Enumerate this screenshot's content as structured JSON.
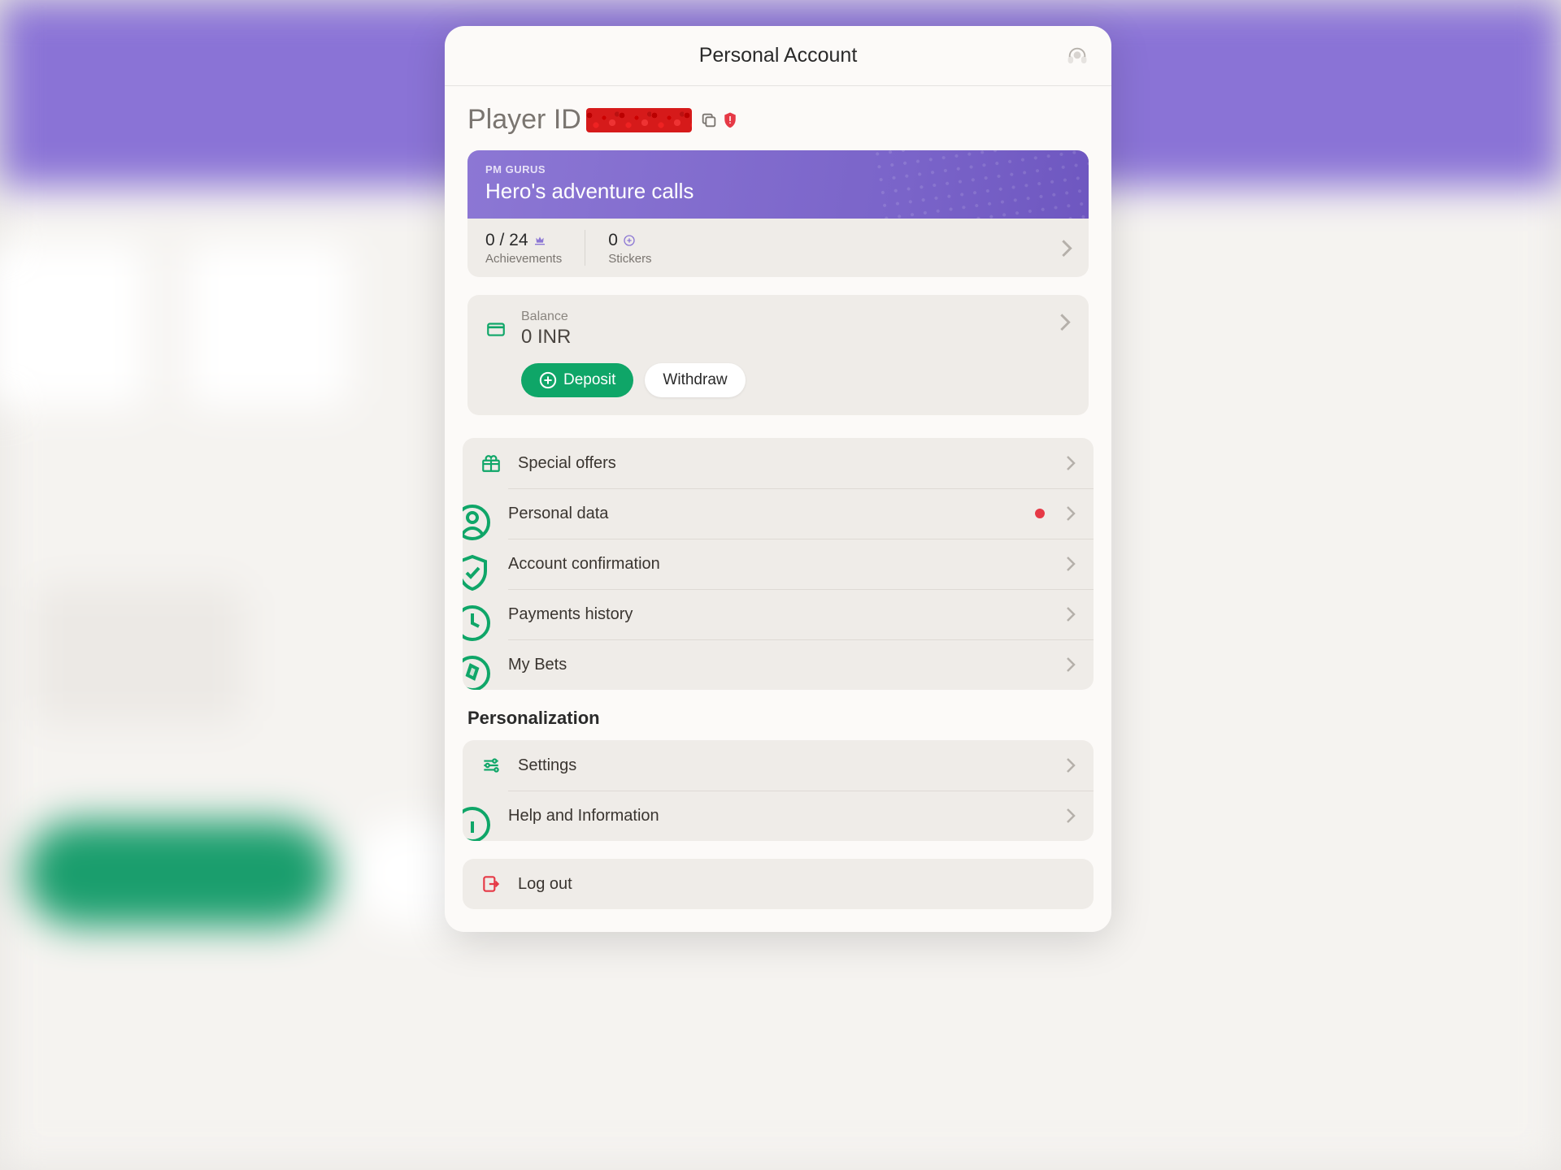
{
  "colors": {
    "accent_green": "#0fa668",
    "accent_purple": "#8c77d4",
    "danger": "#e63946"
  },
  "header": {
    "title": "Personal Account"
  },
  "player": {
    "id_label": "Player ID"
  },
  "hero": {
    "eyebrow": "PM GURUS",
    "title": "Hero's adventure calls",
    "achievements_value": "0 / 24",
    "achievements_label": "Achievements",
    "stickers_value": "0",
    "stickers_label": "Stickers"
  },
  "balance": {
    "label": "Balance",
    "value": "0 INR",
    "deposit_label": "Deposit",
    "withdraw_label": "Withdraw"
  },
  "menu1": {
    "special_offers": "Special offers",
    "personal_data": "Personal data",
    "account_confirmation": "Account confirmation",
    "payments_history": "Payments history",
    "my_bets": "My Bets"
  },
  "personalization": {
    "title": "Personalization",
    "settings": "Settings",
    "help": "Help and Information"
  },
  "logout": {
    "label": "Log out"
  }
}
